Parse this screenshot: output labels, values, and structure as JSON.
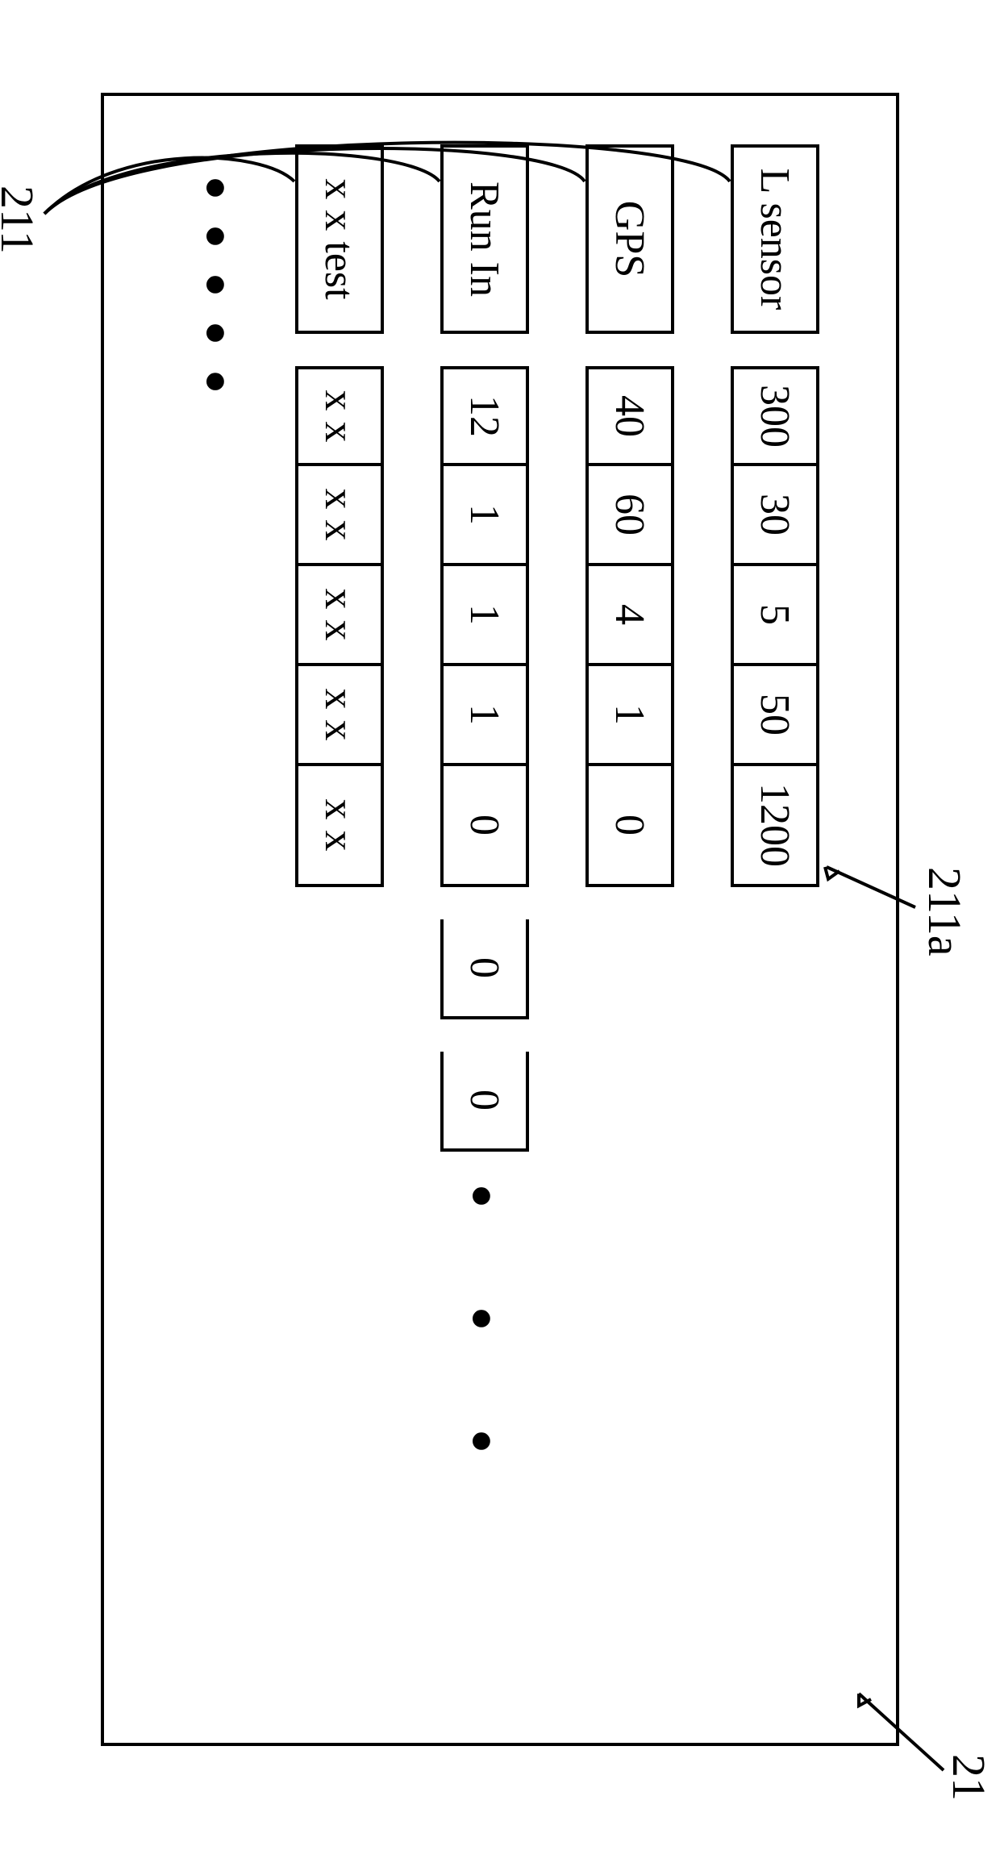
{
  "figure": {
    "ref_main": "21",
    "ref_group": "211",
    "ref_cell": "211a",
    "rows": [
      {
        "label": "L sensor",
        "cells": [
          "300",
          "30",
          "5",
          "50",
          "1200"
        ]
      },
      {
        "label": "GPS",
        "cells": [
          "40",
          "60",
          "4",
          "1",
          "0"
        ]
      },
      {
        "label": "Run In",
        "cells": [
          "12",
          "1",
          "1",
          "1",
          "0",
          "0",
          "0"
        ]
      },
      {
        "label": "x x test",
        "cells": [
          "x x",
          "x x",
          "x x",
          "x x",
          "x x"
        ]
      }
    ],
    "ellipsis_h": "• • •",
    "ellipsis_v": "• • • • •"
  }
}
